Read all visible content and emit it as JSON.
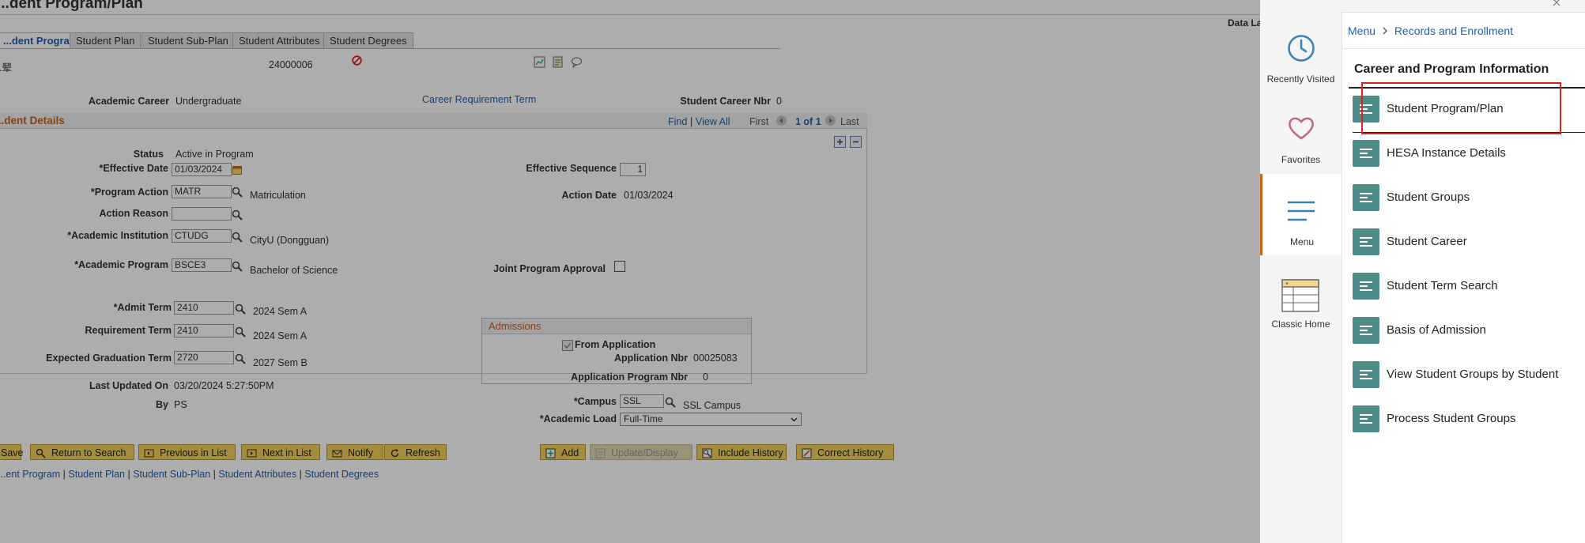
{
  "page": {
    "title": "...dent Program/Plan",
    "data_label": "Data La"
  },
  "tabs": [
    "...dent Program",
    "Student Plan",
    "Student Sub-Plan",
    "Student Attributes",
    "Student Degrees"
  ],
  "header": {
    "name_fragment": "...翚",
    "id": "24000006"
  },
  "career": {
    "academic_career_label": "Academic Career",
    "academic_career_value": "Undergraduate",
    "career_req_term_link": "Career Requirement Term",
    "career_nbr_label": "Student Career Nbr",
    "career_nbr_value": "0"
  },
  "details": {
    "title": "...dent Details",
    "find": "Find",
    "view_all": "View All",
    "first": "First",
    "pager": "1 of 1",
    "last": "Last",
    "status_label": "Status",
    "status_value": "Active in Program",
    "eff_date_label": "*Effective Date",
    "eff_date_value": "01/03/2024",
    "eff_seq_label": "Effective Sequence",
    "eff_seq_value": "1",
    "prog_action_label": "*Program Action",
    "prog_action_value": "MATR",
    "prog_action_desc": "Matriculation",
    "action_date_label": "Action Date",
    "action_date_value": "01/03/2024",
    "action_reason_label": "Action Reason",
    "action_reason_value": "",
    "acad_inst_label": "*Academic Institution",
    "acad_inst_value": "CTUDG",
    "acad_inst_desc": "CityU (Dongguan)",
    "acad_prog_label": "*Academic Program",
    "acad_prog_value": "BSCE3",
    "acad_prog_desc": "Bachelor of Science",
    "joint_label": "Joint Program Approval",
    "admit_term_label": "*Admit Term",
    "admit_term_value": "2410",
    "admit_term_desc": "2024 Sem A",
    "req_term_label": "Requirement Term",
    "req_term_value": "2410",
    "req_term_desc": "2024 Sem A",
    "grad_term_label": "Expected Graduation Term",
    "grad_term_value": "2720",
    "grad_term_desc": "2027 Sem B",
    "last_updated_label": "Last Updated On",
    "last_updated_value": "03/20/2024  5:27:50PM",
    "by_label": "By",
    "by_value": "PS",
    "admissions_title": "Admissions",
    "from_app_label": "From Application",
    "app_nbr_label": "Application Nbr",
    "app_nbr_value": "00025083",
    "app_prog_nbr_label": "Application Program Nbr",
    "app_prog_nbr_value": "0",
    "campus_label": "*Campus",
    "campus_value": "SSL",
    "campus_desc": "SSL Campus",
    "acad_load_label": "*Academic Load",
    "acad_load_value": "Full-Time"
  },
  "buttons": {
    "save": "Save",
    "return_search": "Return to Search",
    "prev_list": "Previous in List",
    "next_list": "Next in List",
    "notify": "Notify",
    "refresh": "Refresh",
    "add": "Add",
    "update_display": "Update/Display",
    "include_history": "Include History",
    "correct_history": "Correct History"
  },
  "bottom_links": [
    "...ent Program",
    "Student Plan",
    "Student Sub-Plan",
    "Student Attributes",
    "Student Degrees"
  ],
  "nav_rail": {
    "recently_visited": "Recently Visited",
    "favorites": "Favorites",
    "menu": "Menu",
    "classic_home": "Classic Home"
  },
  "nav_panel": {
    "breadcrumb_root": "Menu",
    "breadcrumb_current": "Records and Enrollment",
    "section_title": "Career and Program Information",
    "items": [
      "Student Program/Plan",
      "HESA Instance Details",
      "Student Groups",
      "Student Career",
      "Student Term Search",
      "Basis of Admission",
      "View Student Groups by Student",
      "Process Student Groups"
    ]
  },
  "colors": {
    "accent_teal": "#4c8b87",
    "link_blue": "#1d60b3",
    "highlight_red": "#e0211e",
    "section_orange": "#c9621a",
    "button_yellow": "#f2d25c"
  }
}
